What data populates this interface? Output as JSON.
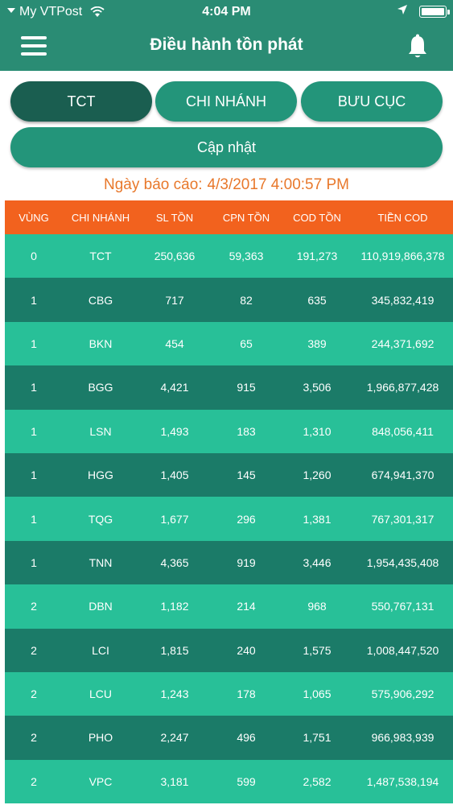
{
  "status_bar": {
    "carrier": "My VTPost",
    "time": "4:04 PM"
  },
  "nav": {
    "title": "Điều hành tồn phát",
    "menu_icon": "hamburger-menu-icon",
    "bell_icon": "bell-icon"
  },
  "segments": {
    "tct": "TCT",
    "chi_nhanh": "CHI NHÁNH",
    "buu_cuc": "BƯU CỤC",
    "selected": "TCT"
  },
  "update_label": "Cập nhật",
  "report": {
    "label": "Ngày báo cáo:",
    "value": "4/3/2017 4:00:57 PM"
  },
  "table": {
    "headers": [
      "VÙNG",
      "CHI NHÁNH",
      "SL TỒN",
      "CPN TỒN",
      "COD TỒN",
      "TIỀN COD"
    ],
    "rows": [
      [
        "0",
        "TCT",
        "250,636",
        "59,363",
        "191,273",
        "110,919,866,378"
      ],
      [
        "1",
        "CBG",
        "717",
        "82",
        "635",
        "345,832,419"
      ],
      [
        "1",
        "BKN",
        "454",
        "65",
        "389",
        "244,371,692"
      ],
      [
        "1",
        "BGG",
        "4,421",
        "915",
        "3,506",
        "1,966,877,428"
      ],
      [
        "1",
        "LSN",
        "1,493",
        "183",
        "1,310",
        "848,056,411"
      ],
      [
        "1",
        "HGG",
        "1,405",
        "145",
        "1,260",
        "674,941,370"
      ],
      [
        "1",
        "TQG",
        "1,677",
        "296",
        "1,381",
        "767,301,317"
      ],
      [
        "1",
        "TNN",
        "4,365",
        "919",
        "3,446",
        "1,954,435,408"
      ],
      [
        "2",
        "DBN",
        "1,182",
        "214",
        "968",
        "550,767,131"
      ],
      [
        "2",
        "LCI",
        "1,815",
        "240",
        "1,575",
        "1,008,447,520"
      ],
      [
        "2",
        "LCU",
        "1,243",
        "178",
        "1,065",
        "575,906,292"
      ],
      [
        "2",
        "PHO",
        "2,247",
        "496",
        "1,751",
        "966,983,939"
      ],
      [
        "2",
        "VPC",
        "3,181",
        "599",
        "2,582",
        "1,487,538,194"
      ]
    ]
  },
  "colors": {
    "primary": "#2a8c74",
    "header_orange": "#f2621e",
    "date_orange": "#e8782b",
    "row_light": "#28c098",
    "row_dark": "#1b7b68"
  }
}
